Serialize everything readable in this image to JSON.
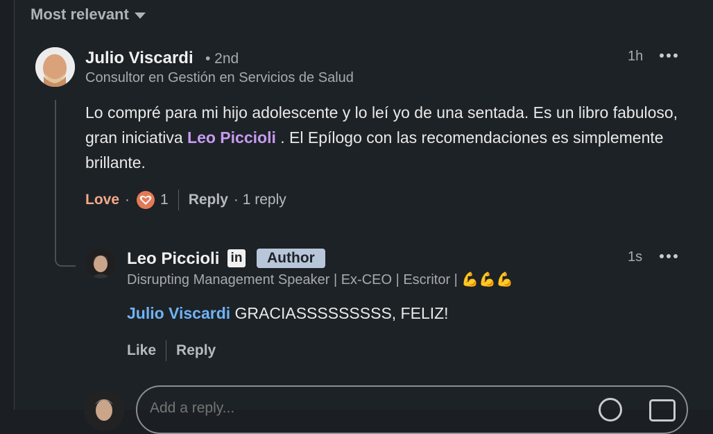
{
  "sort": {
    "label": "Most relevant"
  },
  "comment": {
    "author": "Julio Viscardi",
    "degree": "• 2nd",
    "headline": "Consultor en Gestión en Servicios de Salud",
    "time": "1h",
    "text_before": "Lo compré para mi hijo adolescente y lo leí yo de una sentada. Es un libro fabuloso, gran iniciativa ",
    "mention": "Leo Piccioli",
    "text_after": " . El Epílogo con las recomendaciones es simplemente brillante.",
    "reaction_label": "Love",
    "reaction_dot": "·",
    "reaction_count": "1",
    "reply_label": "Reply",
    "replies_count": "· 1 reply"
  },
  "reply": {
    "author": "Leo Piccioli",
    "linkedin_badge": "in",
    "author_badge": "Author",
    "headline": "Disrupting Management Speaker | Ex-CEO | Escritor | 💪💪💪",
    "time": "1s",
    "mention": "Julio Viscardi",
    "text": " GRACIASSSSSSSSS, FELIZ!",
    "like_label": "Like",
    "reply_label": "Reply"
  },
  "reply_box": {
    "placeholder": "Add a reply..."
  },
  "colors": {
    "mention_purple": "#c79bf2",
    "mention_blue": "#6fb3f5",
    "love": "#f5a88a"
  }
}
